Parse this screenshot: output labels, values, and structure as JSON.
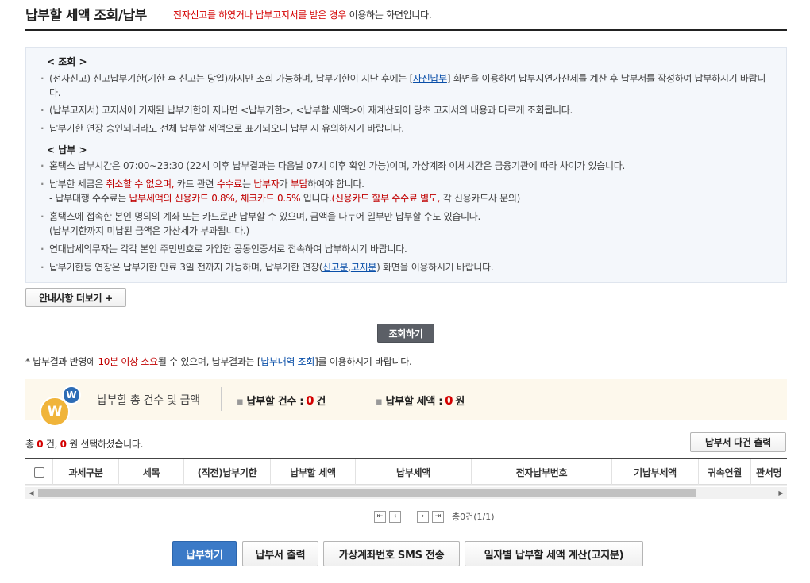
{
  "header": {
    "title": "납부할 세액 조회/납부",
    "note_red": "전자신고를 하였거나 납부고지서를 받은 경우",
    "note_rest": " 이용하는 화면입니다."
  },
  "guide": {
    "inquiry_head": "< 조회 >",
    "inquiry": {
      "b1_pre": "(전자신고) 신고납부기한(기한 후 신고는 당일)까지만 조회 가능하며, 납부기한이 지난 후에는 [",
      "b1_link": "자진납부",
      "b1_post": "] 화면을 이용하여 납부지연가산세를 계산 후 납부서를 작성하여 납부하시기 바랍니다.",
      "b2": "(납부고지서) 고지서에 기재된 납부기한이 지나면 <납부기한>, <납부할 세액>이 재계산되어 당초 고지서의 내용과 다르게 조회됩니다.",
      "b3": "납부기한 연장 승인되더라도 전체 납부할 세액으로 표기되오니 납부 시 유의하시기 바랍니다."
    },
    "pay_head": "< 납부 >",
    "pay": {
      "b1": "홈택스 납부시간은 07:00~23:30 (22시 이후 납부결과는 다음날 07시 이후 확인 가능)이며, 가상계좌 이체시간은 금융기관에 따라 차이가 있습니다.",
      "b2_a": "납부한 세금은 ",
      "b2_red1": "취소할 수 없으며,",
      "b2_b": " 카드 관련 ",
      "b2_red2": "수수료",
      "b2_c": "는 ",
      "b2_red3": "납부자",
      "b2_d": "가 ",
      "b2_red4": "부담",
      "b2_e": "하여야 합니다.",
      "b2_l2_a": "- 납부대행 수수료는 ",
      "b2_l2_red1": "납부세액의 신용카드 0.8%, 체크카드 0.5%",
      "b2_l2_b": " 입니다.",
      "b2_l2_red2": "(신용카드 할부 수수료 별도,",
      "b2_l2_c": " 각 신용카드사 문의)",
      "b3_l1": "홈택스에 접속한 본인 명의의 계좌 또는 카드로만 납부할 수 있으며, 금액을 나누어 일부만 납부할 수도 있습니다.",
      "b3_l2": "(납부기한까지 미납된 금액은 가산세가 부과됩니다.)",
      "b4": "연대납세의무자는 각각 본인 주민번호로 가입한 공동인증서로 접속하여 납부하시기 바랍니다.",
      "b5_pre": "납부기한등 연장은 납부기한 만료 3일 전까지 가능하며, 납부기한 연장(",
      "b5_link1": "신고분",
      "b5_comma": ",",
      "b5_link2": "고지분",
      "b5_post": ") 화면을 이용하시기 바랍니다."
    }
  },
  "buttons": {
    "more": "안내사항 더보기 +",
    "query": "조회하기",
    "print_multi": "납부서 다건 출력",
    "pay": "납부하기",
    "print_bill": "납부서 출력",
    "sms": "가상계좌번호 SMS 전송",
    "calc": "일자별 납부할 세액 계산(고지분)"
  },
  "result_note": {
    "a": "* 납부결과 반영에 ",
    "red": "10분 이상 소요",
    "b": "될 수 있으며, 납부결과는 [",
    "link": "납부내역 조회",
    "c": "]를 이용하시기 바랍니다."
  },
  "summary": {
    "label": "납부할 총 건수 및 금액",
    "count_label": "납부할 건수 :",
    "count_value": "0",
    "count_unit": "건",
    "amount_label": "납부할 세액 :",
    "amount_value": "0",
    "amount_unit": "원",
    "logo_big": "W",
    "logo_small": "W"
  },
  "selection": {
    "prefix": "총 ",
    "total": "0",
    "mid": " 건, ",
    "selected": "0",
    "suffix": " 원 선택하셨습니다."
  },
  "table": {
    "columns": [
      "과세구분",
      "세목",
      "(직전)납부기한",
      "납부할 세액",
      "납부세액",
      "전자납부번호",
      "기납부세액",
      "귀속연월",
      "관서명"
    ]
  },
  "pager": {
    "first": "⇤",
    "prev": "‹",
    "next": "›",
    "last": "⇥",
    "info": "총0건(1/1)"
  }
}
